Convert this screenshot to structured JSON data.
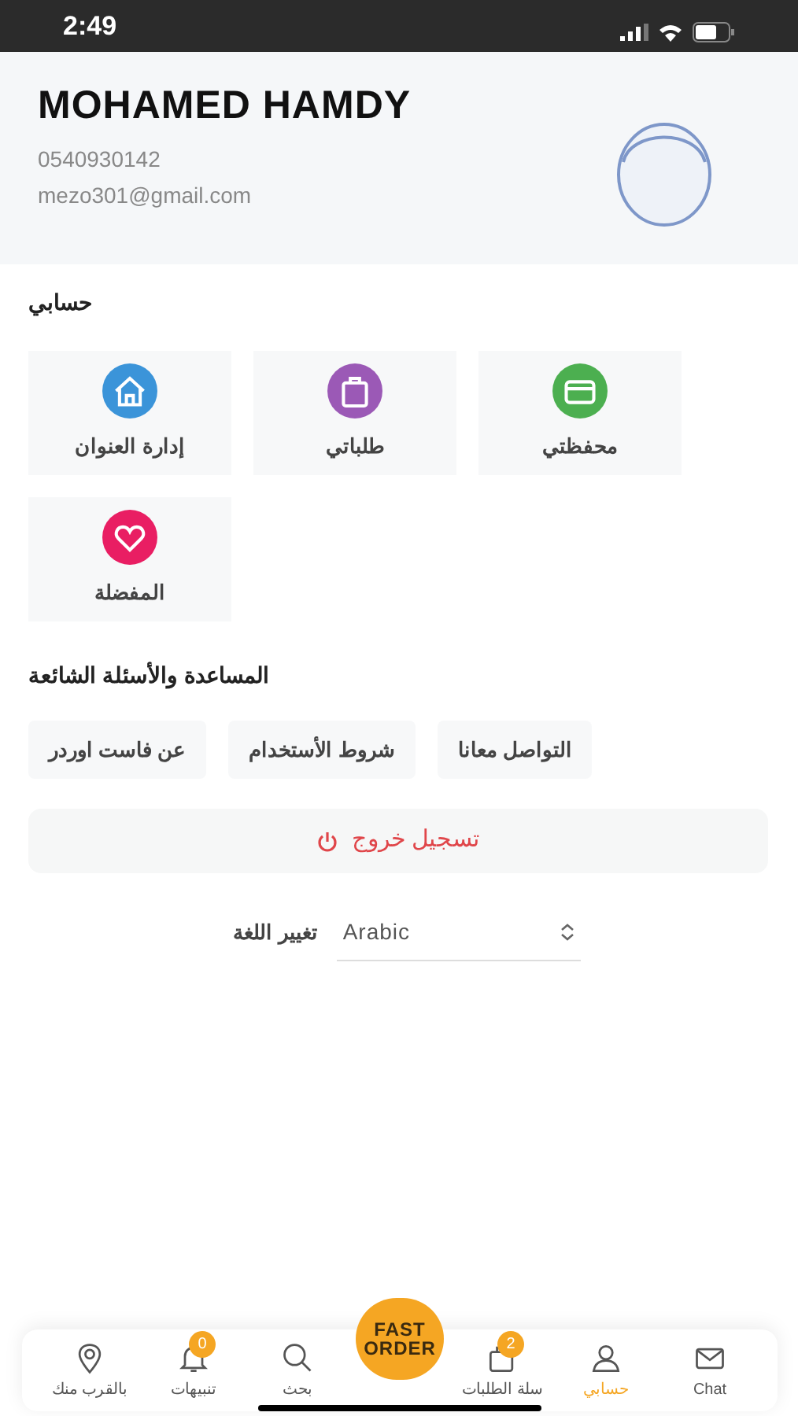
{
  "status_bar": {
    "time": "2:49"
  },
  "profile": {
    "name": "MOHAMED HAMDY",
    "phone": "0540930142",
    "email": "mezo301@gmail.com"
  },
  "account": {
    "title": "حسابي",
    "tiles": [
      {
        "label": "محفظتي",
        "kind": "wallet",
        "color": "#4caf50"
      },
      {
        "label": "طلباتي",
        "kind": "bag",
        "color": "#9b59b6"
      },
      {
        "label": "إدارة العنوان",
        "kind": "home",
        "color": "#3b94d9"
      },
      {
        "label": "المفضلة",
        "kind": "heart",
        "color": "#e91e63"
      }
    ]
  },
  "help": {
    "title": "المساعدة والأسئلة الشائعة",
    "buttons": [
      "التواصل معانا",
      "شروط الأستخدام",
      "عن فاست اوردر"
    ]
  },
  "logout": {
    "label": "تسجيل خروج"
  },
  "language": {
    "label": "تغيير اللغة",
    "value": "Arabic"
  },
  "tab_bar": {
    "center": {
      "line1": "FAST",
      "line2": "ORDER"
    },
    "tabs": [
      {
        "label": "Chat",
        "kind": "mail",
        "selected": false
      },
      {
        "label": "حسابي",
        "kind": "user",
        "selected": true
      },
      {
        "label": "سلة الطلبات",
        "kind": "bag",
        "selected": false,
        "badge": "2"
      },
      {
        "label": "بحث",
        "kind": "search",
        "selected": false
      },
      {
        "label": "تنبيهات",
        "kind": "bell",
        "selected": false,
        "badge": "0"
      },
      {
        "label": "بالقرب منك",
        "kind": "pin",
        "selected": false
      }
    ]
  }
}
